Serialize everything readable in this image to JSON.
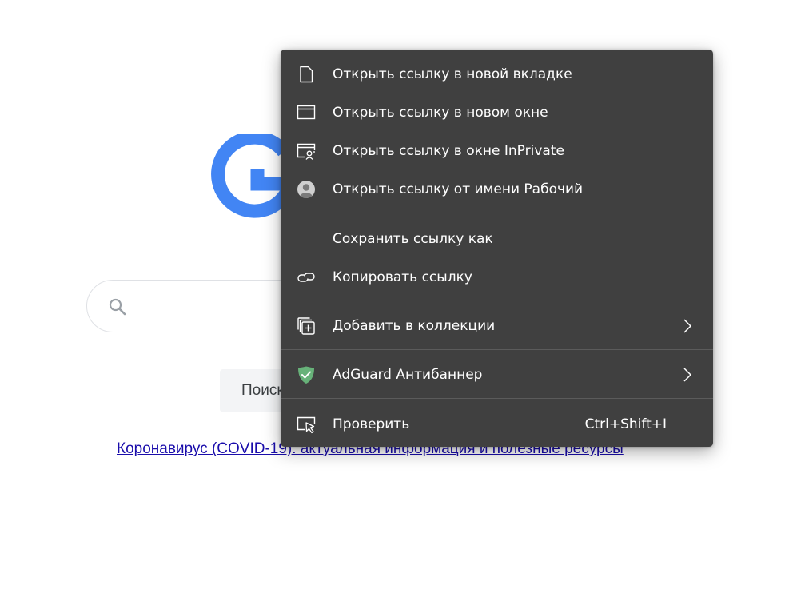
{
  "background": {
    "logo_fragment_color": "#4285f4",
    "search_input_placeholder": "",
    "search_button_label": "Поиск",
    "covid_link_text": "Коронавирус (COVID-19): актуальная информация и полезные ресурсы"
  },
  "context_menu": {
    "background_color": "#404040",
    "items": [
      {
        "label": "Открыть ссылку в новой вкладке",
        "icon": "new-tab-icon"
      },
      {
        "label": "Открыть ссылку в новом окне",
        "icon": "new-window-icon"
      },
      {
        "label": "Открыть ссылку в окне InPrivate",
        "icon": "inprivate-window-icon"
      },
      {
        "label": "Открыть ссылку от имени Рабочий",
        "icon": "profile-avatar-icon"
      },
      {
        "label": "Сохранить ссылку как",
        "icon": ""
      },
      {
        "label": "Копировать ссылку",
        "icon": "link-icon"
      },
      {
        "label": "Добавить в коллекции",
        "icon": "collections-add-icon",
        "submenu": true
      },
      {
        "label": "AdGuard Антибаннер",
        "icon": "adguard-shield-icon",
        "submenu": true,
        "icon_color": "#67b279"
      },
      {
        "label": "Проверить",
        "icon": "inspect-icon",
        "shortcut": "Ctrl+Shift+I"
      }
    ]
  }
}
